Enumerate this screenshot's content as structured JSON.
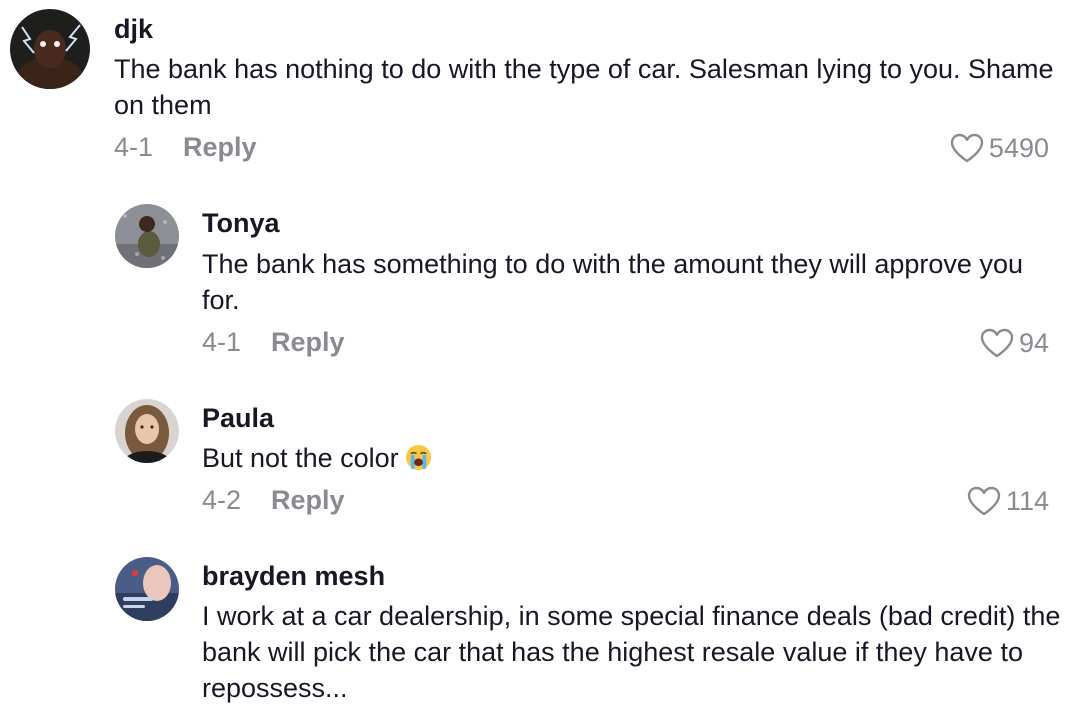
{
  "comments": [
    {
      "username": "djk",
      "text": "The bank has nothing to do with the type of car. Salesman lying to you. Shame on them",
      "date": "4-1",
      "reply_label": "Reply",
      "likes": "5490"
    },
    {
      "username": "Tonya",
      "text": "The bank has something to do with the amount they will approve you for.",
      "date": "4-1",
      "reply_label": "Reply",
      "likes": "94"
    },
    {
      "username": "Paula",
      "text": "But not the color",
      "emoji": "loudly-crying-face",
      "date": "4-2",
      "reply_label": "Reply",
      "likes": "114"
    },
    {
      "username": "brayden mesh",
      "text": "I work at a car dealership, in some special finance deals (bad credit) the bank will pick the car that has the highest resale value if they have to repossess..."
    }
  ],
  "colors": {
    "text": "#161823",
    "secondary": "#8a8b91",
    "background": "#ffffff"
  }
}
